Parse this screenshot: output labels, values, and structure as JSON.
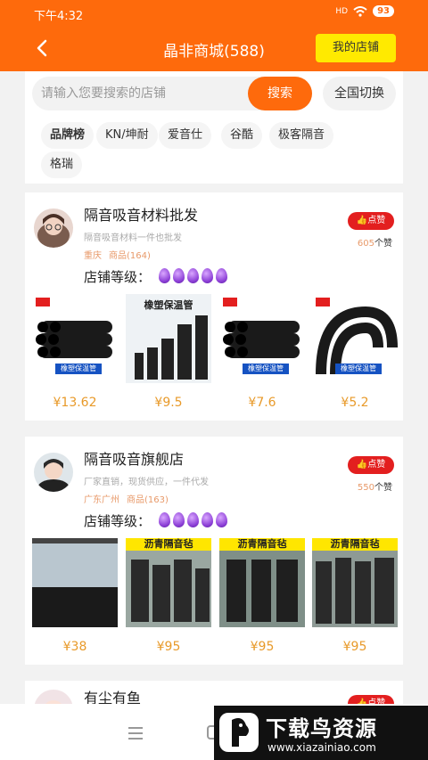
{
  "status_bar": {
    "time": "下午4:32",
    "network": "HD",
    "battery": "93"
  },
  "header": {
    "title": "晶非商城(588)",
    "my_shop_label": "我的店铺"
  },
  "search": {
    "placeholder": "请输入您要搜索的店铺",
    "button_label": "搜索",
    "switch_label": "全国切换"
  },
  "brands": [
    "品牌榜",
    "KN/坤耐",
    "爱音仕",
    "谷酷",
    "极客隔音",
    "格瑞"
  ],
  "shops": [
    {
      "name": "隔音吸音材料批发",
      "description": "隔音吸音材料一件也批发",
      "location": "重庆",
      "product_count": "商品(164)",
      "like_label": "点赞",
      "like_count": "605",
      "like_unit": "个赞",
      "level_label": "店铺等级：",
      "level_gems": 5,
      "products": [
        {
          "price": "¥13.62",
          "banner": "橡塑保温管"
        },
        {
          "price": "¥9.5",
          "title": "橡塑保温管"
        },
        {
          "price": "¥7.6",
          "banner": "橡塑保温管"
        },
        {
          "price": "¥5.2",
          "banner": "橡塑保温管"
        }
      ]
    },
    {
      "name": "隔音吸音旗舰店",
      "description": "厂家直销，现货供应，一件代发",
      "location": "广东广州",
      "product_count": "商品(163)",
      "like_label": "点赞",
      "like_count": "550",
      "like_unit": "个赞",
      "level_label": "店铺等级：",
      "level_gems": 5,
      "products": [
        {
          "price": "¥38"
        },
        {
          "price": "¥95",
          "title": "沥青隔音毡"
        },
        {
          "price": "¥95",
          "title": "沥青隔音毡"
        },
        {
          "price": "¥95",
          "title": "沥青隔音毡"
        }
      ]
    },
    {
      "name": "有尘有鱼",
      "like_label": "点赞"
    }
  ],
  "watermark": {
    "main": "下载鸟资源",
    "sub": "www.xiazainiao.com"
  },
  "colors": {
    "brand_orange": "#fe6a0c",
    "accent_yellow": "#ffea00",
    "like_red": "#e31f1f",
    "price_orange": "#e89a2a"
  }
}
